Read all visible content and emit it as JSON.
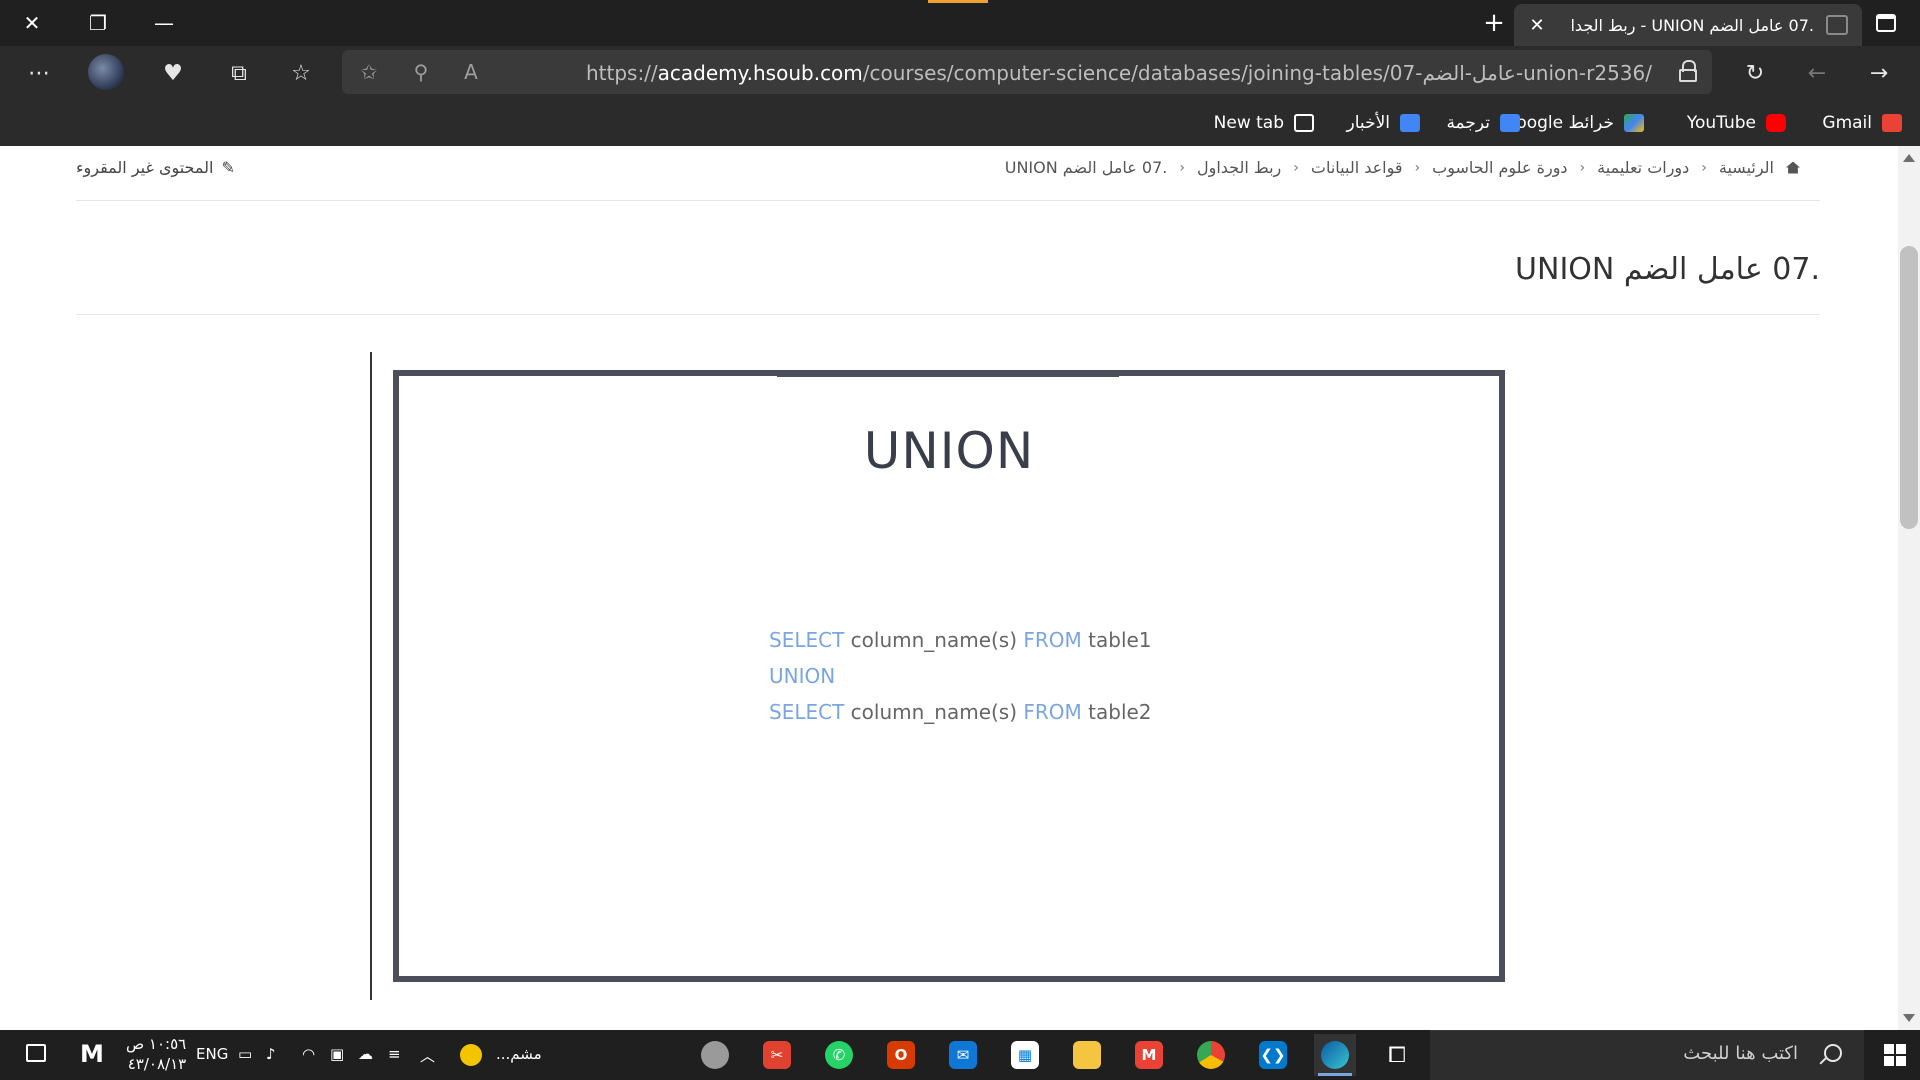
{
  "browser": {
    "tab_title": ".07 عامل الضم UNION - ربط الجدا",
    "url_scheme": "https://",
    "url_domain": "academy.hsoub.com",
    "url_path": "/courses/computer-science/databases/joining-tables/07-عامل-الضم-union-r2536/",
    "bookmarks": [
      {
        "label": "Gmail",
        "icon": "gmail-icon",
        "color": "#ea4335"
      },
      {
        "label": "YouTube",
        "icon": "youtube-icon",
        "color": "#ff0000"
      },
      {
        "label": "خرائط Google",
        "icon": "maps-icon",
        "color": "#34a853"
      },
      {
        "label": "ترجمة",
        "icon": "translate-icon",
        "color": "#4285f4"
      },
      {
        "label": "الأخبار",
        "icon": "news-icon",
        "color": "#4285f4"
      },
      {
        "label": "New tab",
        "icon": "newtab-icon",
        "color": "#ffffff"
      }
    ]
  },
  "page": {
    "breadcrumb": [
      "الرئيسية",
      "دورات تعليمية",
      "دورة علوم الحاسوب",
      "قواعد البيانات",
      "ربط الجداول",
      ".07 عامل الضم UNION"
    ],
    "unread_link": "المحتوى غير المقروء",
    "title": ".07 عامل الضم UNION",
    "slide": {
      "title": "UNION",
      "code": {
        "line1_kw1": "SELECT",
        "line1_text1": " column_name(s) ",
        "line1_kw2": "FROM",
        "line1_text2": " table1",
        "line2_kw": "UNION",
        "line3_kw1": "SELECT",
        "line3_text1": " column_name(s) ",
        "line3_kw2": "FROM",
        "line3_text2": " table2"
      }
    }
  },
  "taskbar": {
    "search_placeholder": "اكتب هنا للبحث",
    "weather_text": "مشم...",
    "language": "ENG",
    "time": "١٠:٥٦ ص",
    "date": "٤٣/٠٨/١٣"
  },
  "colors": {
    "accent": "#7aa6e0",
    "frame": "#4b4f5c"
  }
}
